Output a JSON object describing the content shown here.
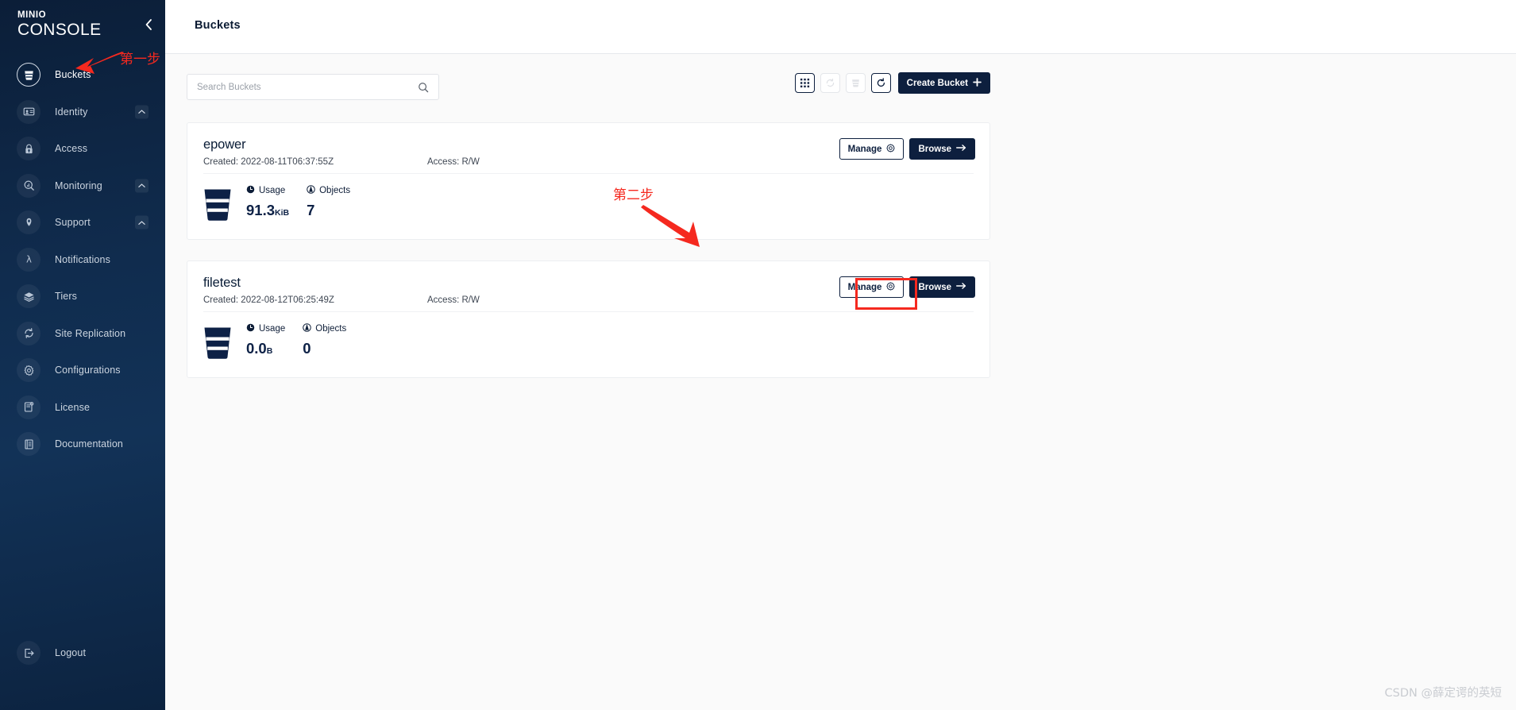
{
  "brand": {
    "logo_top": "MINIO",
    "logo_bottom": "CONSOLE",
    "collapse_icon": "chevron-left-icon"
  },
  "colors": {
    "sidebar_bg_top": "#0b1e38",
    "sidebar_bg_mid": "#123257",
    "accent_dark": "#0d1f3e",
    "annotation_red": "#f5291f",
    "page_bg": "#fafafa",
    "card_bg": "#ffffff"
  },
  "sidebar": {
    "items": [
      {
        "label": "Buckets",
        "icon": "bucket-icon",
        "active": true,
        "caret": false
      },
      {
        "label": "Identity",
        "icon": "identity-card-icon",
        "active": false,
        "caret": true
      },
      {
        "label": "Access",
        "icon": "lock-icon",
        "active": false,
        "caret": false
      },
      {
        "label": "Monitoring",
        "icon": "magnifier-chart-icon",
        "active": false,
        "caret": true
      },
      {
        "label": "Support",
        "icon": "support-hands-icon",
        "active": false,
        "caret": true
      },
      {
        "label": "Notifications",
        "icon": "lambda-icon",
        "active": false,
        "caret": false
      },
      {
        "label": "Tiers",
        "icon": "layers-icon",
        "active": false,
        "caret": false
      },
      {
        "label": "Site Replication",
        "icon": "replication-icon",
        "active": false,
        "caret": false
      },
      {
        "label": "Configurations",
        "icon": "gear-icon",
        "active": false,
        "caret": false
      },
      {
        "label": "License",
        "icon": "certificate-icon",
        "active": false,
        "caret": false
      },
      {
        "label": "Documentation",
        "icon": "book-icon",
        "active": false,
        "caret": false
      }
    ],
    "logout": {
      "label": "Logout",
      "icon": "logout-icon"
    }
  },
  "header": {
    "title": "Buckets"
  },
  "toolbar": {
    "search": {
      "placeholder": "Search Buckets",
      "value": "",
      "icon": "search-icon"
    },
    "icon_buttons": [
      {
        "name": "grid-view-icon",
        "enabled": true
      },
      {
        "name": "refresh-sync-icon",
        "enabled": false
      },
      {
        "name": "delete-bucket-icon",
        "enabled": false
      },
      {
        "name": "reload-icon",
        "enabled": true
      }
    ],
    "create_bucket_label": "Create Bucket",
    "create_bucket_icon": "plus-icon"
  },
  "buckets": [
    {
      "name": "epower",
      "created_label": "Created: 2022-08-11T06:37:55Z",
      "access_label": "Access: R/W",
      "usage_label": "Usage",
      "usage_value": "91.3",
      "usage_unit": "KiB",
      "objects_label": "Objects",
      "objects_value": "7",
      "manage_label": "Manage",
      "manage_icon": "gear-icon",
      "browse_label": "Browse",
      "browse_icon": "arrow-right-icon",
      "highlighted": false
    },
    {
      "name": "filetest",
      "created_label": "Created: 2022-08-12T06:25:49Z",
      "access_label": "Access: R/W",
      "usage_label": "Usage",
      "usage_value": "0.0",
      "usage_unit": "B",
      "objects_label": "Objects",
      "objects_value": "0",
      "manage_label": "Manage",
      "manage_icon": "gear-icon",
      "browse_label": "Browse",
      "browse_icon": "arrow-right-icon",
      "highlighted": true
    }
  ],
  "annotations": {
    "step1_text": "第一步",
    "step2_text": "第二步",
    "arrow_icon": "red-arrow-icon",
    "highlight_box": "red-highlight-rectangle"
  },
  "watermark": {
    "text": "CSDN @薛定谔的英短"
  }
}
